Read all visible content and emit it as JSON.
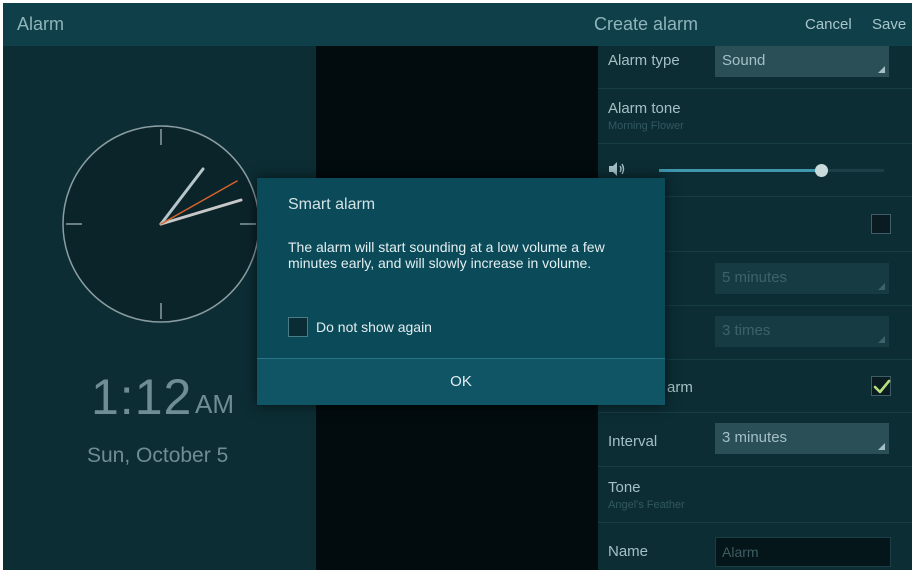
{
  "header": {
    "app_title": "Alarm",
    "create_title": "Create alarm",
    "cancel_label": "Cancel",
    "save_label": "Save"
  },
  "clock": {
    "time": "1:12",
    "ampm": "AM",
    "date": "Sun, October 5"
  },
  "settings": {
    "alarm_type": {
      "label": "Alarm type",
      "value": "Sound"
    },
    "alarm_tone": {
      "label": "Alarm tone",
      "value": "Morning Flower"
    },
    "volume_level": 0.72,
    "smart_checked": false,
    "snooze_duration_value": "5 minutes",
    "snooze_repeat_value": "3 times",
    "smart_alarm_label_partial": "arm",
    "smart_alarm_checked": true,
    "interval": {
      "label": "Interval",
      "value": "3 minutes"
    },
    "tone": {
      "label": "Tone",
      "value": "Angel's Feather"
    },
    "name": {
      "label": "Name",
      "placeholder": "Alarm"
    }
  },
  "dialog": {
    "title": "Smart alarm",
    "body": "The alarm will start sounding at a low volume a few minutes early, and will slowly increase in volume.",
    "checkbox_label": "Do not show again",
    "checkbox_checked": false,
    "ok_label": "OK"
  },
  "colors": {
    "accent": "#3f96ad",
    "hour_hand": "#b7c6c9",
    "minute_hand": "#c8c8c8",
    "second_hand": "#d6632a",
    "check": "#b6e07a"
  },
  "icons": {
    "volume": "speaker-icon",
    "dropdown": "dropdown-triangle-icon",
    "check": "checkmark-icon"
  }
}
